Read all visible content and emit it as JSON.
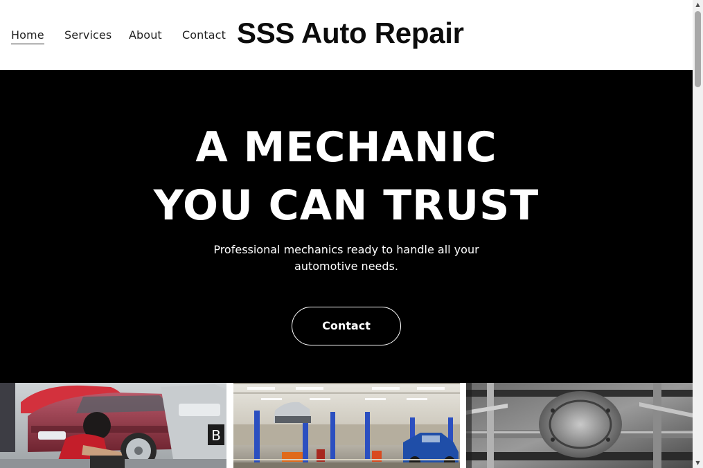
{
  "nav": {
    "items": [
      {
        "label": "Home",
        "active": true
      },
      {
        "label": "Services",
        "active": false
      },
      {
        "label": "About",
        "active": false
      },
      {
        "label": "Contact",
        "active": false
      }
    ]
  },
  "brand": {
    "title": "SSS Auto Repair"
  },
  "hero": {
    "title_line1": "A MECHANIC",
    "title_line2": "YOU CAN TRUST",
    "subtitle": "Professional mechanics ready to handle all your automotive needs.",
    "button_label": "Contact"
  },
  "gallery": {
    "images": [
      {
        "name": "mechanic-working-on-car-photo",
        "plate_text": "B"
      },
      {
        "name": "service-garage-lifts-photo"
      },
      {
        "name": "car-undercarriage-photo"
      }
    ]
  },
  "colors": {
    "hero_background": "#000000",
    "header_background": "#ffffff",
    "text_dark": "#1f1f1f",
    "text_light": "#ffffff"
  },
  "icons": {
    "scroll_up": "chevron-up-icon",
    "scroll_down": "chevron-down-icon"
  }
}
